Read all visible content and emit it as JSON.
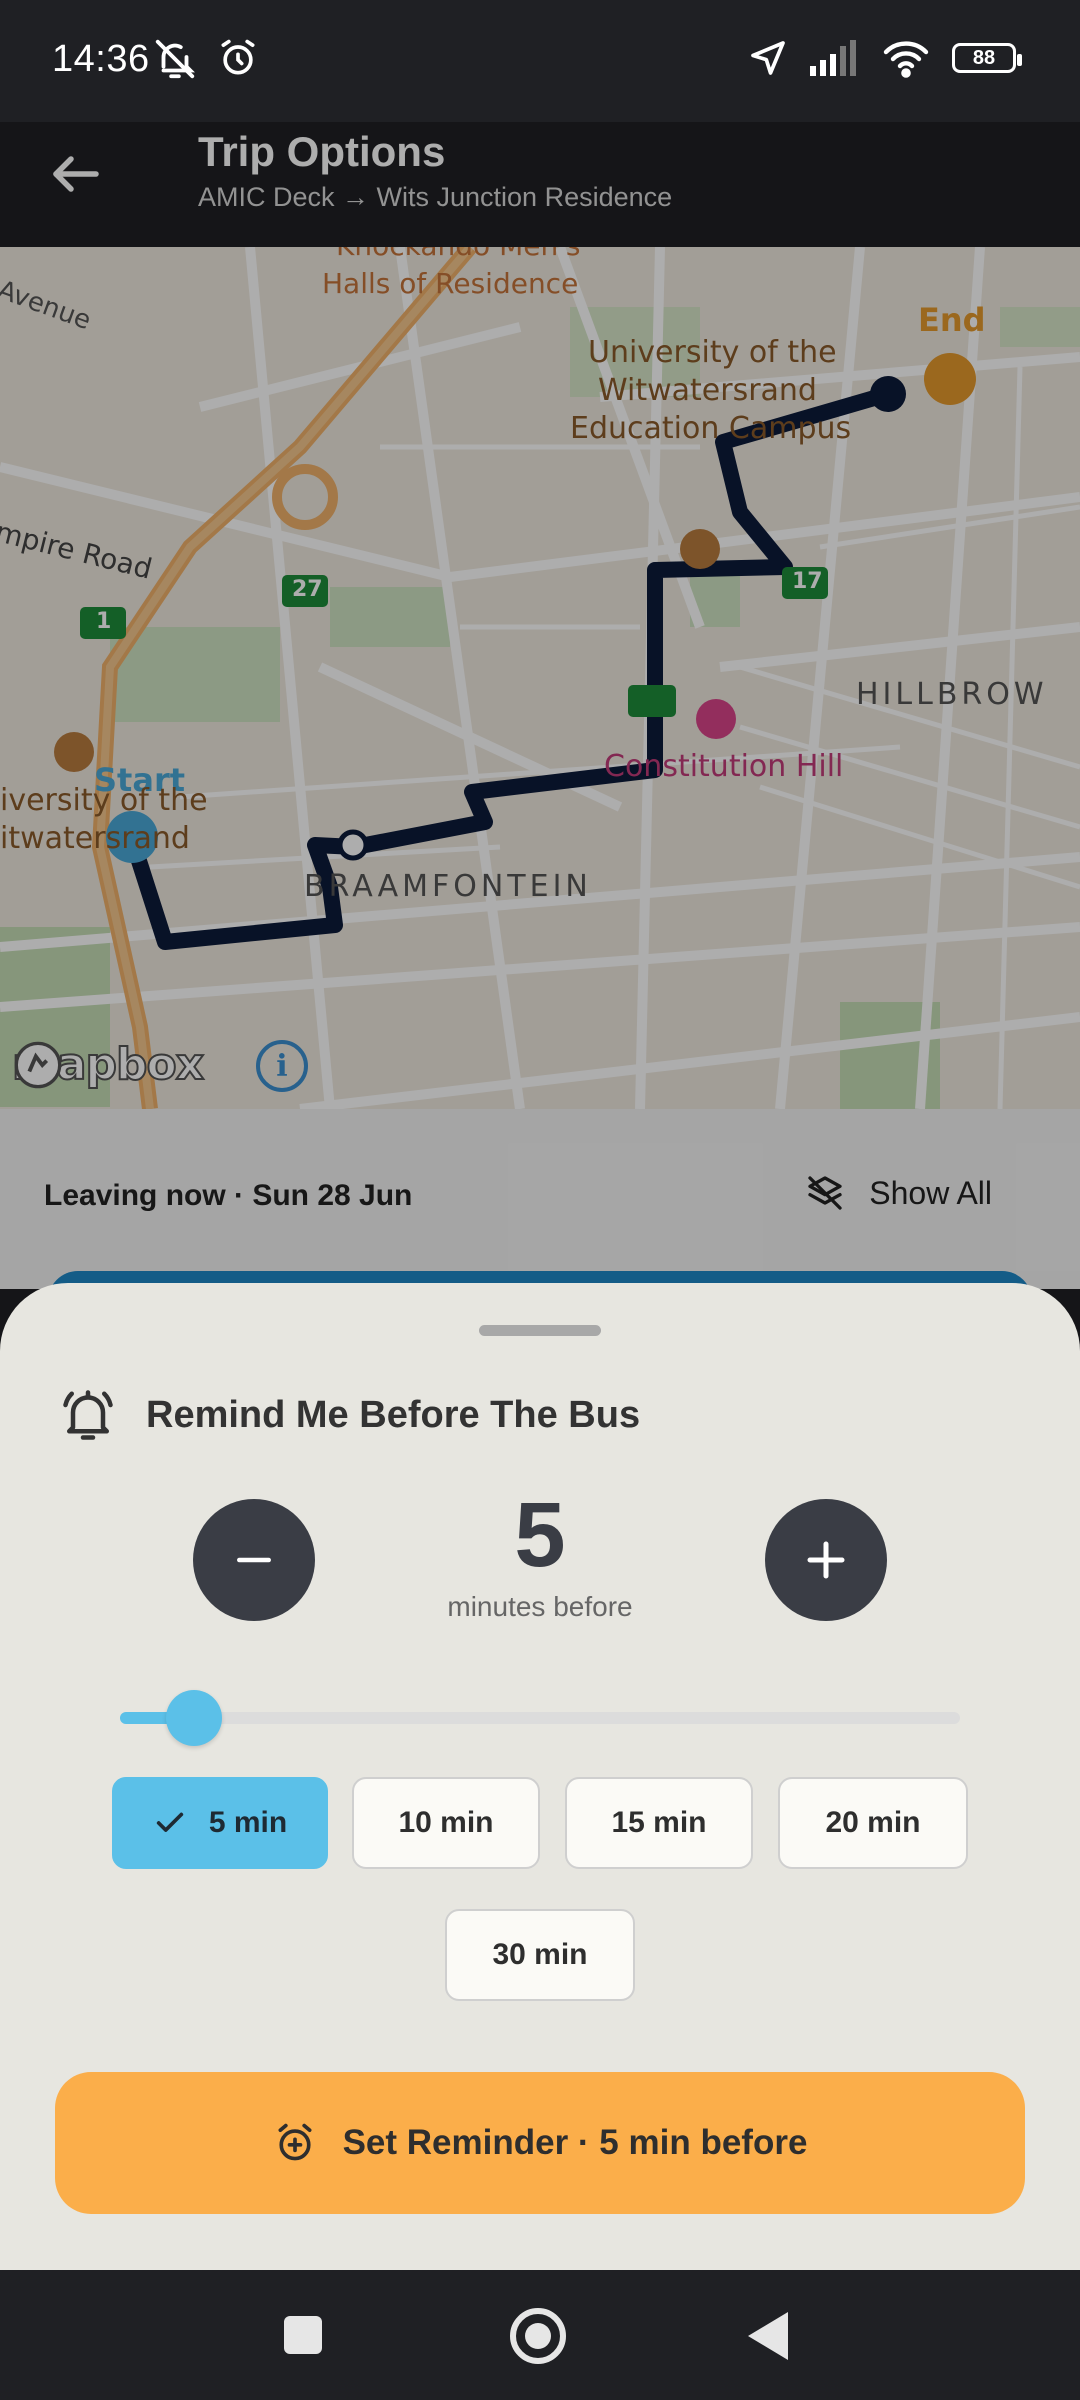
{
  "status_bar": {
    "time": "14:36",
    "battery": "88"
  },
  "app_bar": {
    "title": "Trip Options",
    "subtitle": "AMIC Deck → Wits Junction Residence"
  },
  "map": {
    "labels": {
      "knockando": "Knockando Men's",
      "halls": "Halls of Residence",
      "avenue": "Avenue",
      "empire_road": "mpire Road",
      "uni_edu_1": "University of the",
      "uni_edu_2": "Witwatersrand",
      "uni_edu_3": "Education Campus",
      "end": "End",
      "start": "Start",
      "uni_1": "iversity of the",
      "uni_2": "itwatersrand",
      "hillbrow": "HILLBROW",
      "constitution_hill": "Constitution Hill",
      "braamfontein": "BRAAMFONTEIN",
      "route_27": "27",
      "route_1": "1",
      "route_17": "17"
    },
    "attribution": "mapbox",
    "info": "i"
  },
  "trip": {
    "leaving": "Leaving now · Sun 28 Jun",
    "show_all": "Show All"
  },
  "sheet": {
    "title": "Remind Me Before The Bus",
    "value": "5",
    "unit": "minutes before",
    "slider_fraction": 0.055,
    "chips": [
      "5 min",
      "10 min",
      "15 min",
      "20 min",
      "30 min"
    ],
    "selected_chip": "5 min",
    "set_button": "Set Reminder · 5 min before"
  },
  "colors": {
    "accent_blue": "#5bc0e8",
    "button_orange": "#fbae4a",
    "route_navy": "#0d1b3a",
    "stepper_dark": "#3a3d45"
  }
}
